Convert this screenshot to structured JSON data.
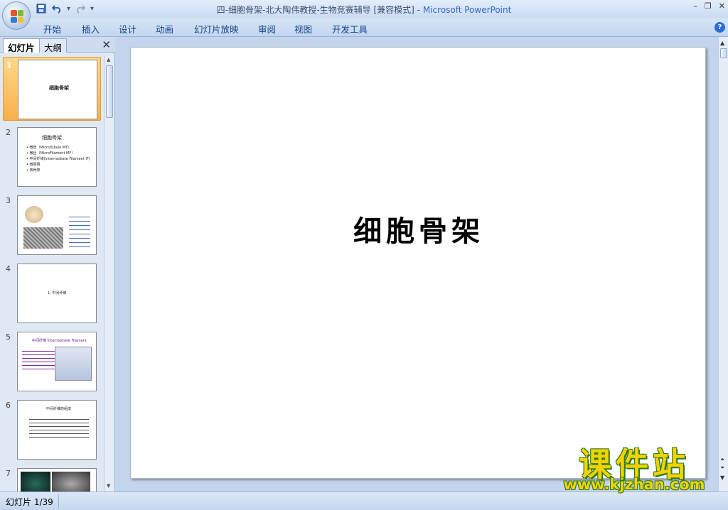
{
  "window": {
    "title_doc": "四-细胞骨架-北大陶伟教授-生物竞赛辅导 [兼容模式]",
    "title_sep": " - ",
    "title_app": "Microsoft PowerPoint",
    "minimize": "–",
    "maximize": "❐",
    "close": "✕"
  },
  "qat": {
    "save_icon": "save-icon",
    "undo_icon": "undo-icon",
    "redo_icon": "redo-icon",
    "customize_icon": "dropdown-icon"
  },
  "ribbon": {
    "tabs": [
      "开始",
      "插入",
      "设计",
      "动画",
      "幻灯片放映",
      "审阅",
      "视图",
      "开发工具"
    ],
    "help": "?"
  },
  "left_pane": {
    "tab_slides": "幻灯片",
    "tab_outline": "大纲",
    "close": "✕",
    "thumbnails": [
      {
        "num": "1",
        "lines": [
          "细胞骨架"
        ]
      },
      {
        "num": "2",
        "lines": [
          "细胞骨架",
          "• 微管（MicroTubule MT）",
          "• 微丝（MicroFilament MF）",
          "• 中间纤维(Intermediate Filament IF)",
          "• 微梁网",
          "• 核骨架"
        ]
      },
      {
        "num": "3",
        "lines": []
      },
      {
        "num": "4",
        "lines": [
          "1. 中间纤维"
        ]
      },
      {
        "num": "5",
        "lines": [
          "中间纤维 Intermediate Filament"
        ]
      },
      {
        "num": "6",
        "lines": [
          "中间纤维的组成"
        ]
      },
      {
        "num": "7",
        "lines": []
      }
    ]
  },
  "slide": {
    "title": "细胞骨架"
  },
  "status": {
    "slide_counter": "幻灯片 1/39"
  },
  "watermark": {
    "main": "课件站",
    "url": "www.kjzhan.com"
  }
}
